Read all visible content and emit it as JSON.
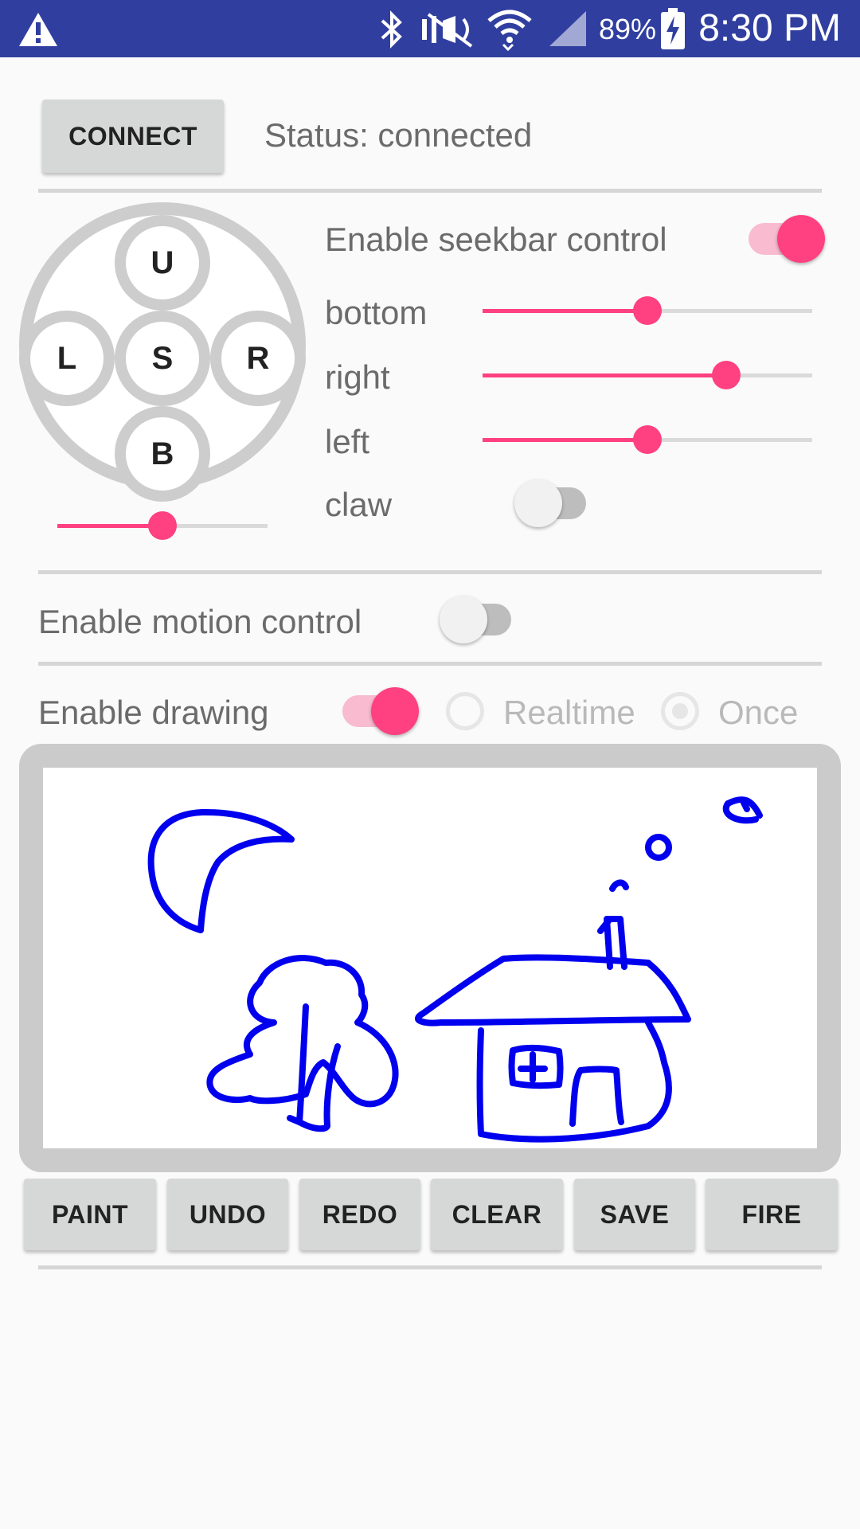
{
  "status_bar": {
    "time": "8:30 PM",
    "battery": "89%",
    "icons": [
      "warning-icon",
      "bluetooth-icon",
      "mute-icon",
      "wifi-icon",
      "signal-icon",
      "battery-charging-icon"
    ]
  },
  "connect": {
    "button_label": "CONNECT",
    "status_text": "Status: connected"
  },
  "dpad": {
    "up": "U",
    "left": "L",
    "stop": "S",
    "right": "R",
    "back": "B",
    "speed_level": 0.5
  },
  "seekbar_control": {
    "label": "Enable seekbar control",
    "enabled": true,
    "sliders": [
      {
        "label": "bottom",
        "value": 0.5
      },
      {
        "label": "right",
        "value": 0.74
      },
      {
        "label": "left",
        "value": 0.5
      }
    ],
    "claw": {
      "label": "claw",
      "enabled": false
    }
  },
  "motion_control": {
    "label": "Enable motion control",
    "enabled": false
  },
  "drawing": {
    "label": "Enable drawing",
    "enabled": true,
    "modes": [
      {
        "label": "Realtime",
        "selected": false
      },
      {
        "label": "Once",
        "selected": true
      }
    ],
    "stroke_color": "#0000ee"
  },
  "toolbar": {
    "paint": "PAINT",
    "undo": "UNDO",
    "redo": "REDO",
    "clear": "CLEAR",
    "save": "SAVE",
    "fire": "FIRE"
  },
  "colors": {
    "accent": "#ff4081",
    "primary_dark": "#303f9f"
  }
}
